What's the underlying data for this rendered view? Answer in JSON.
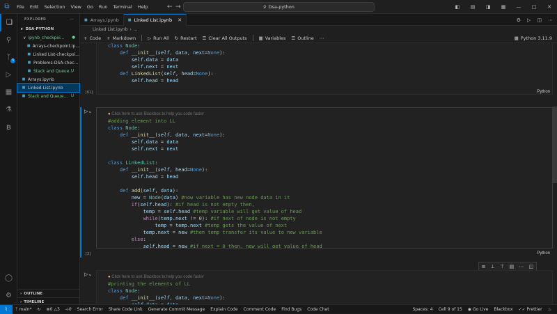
{
  "window": {
    "menu": [
      "File",
      "Edit",
      "Selection",
      "View",
      "Go",
      "Run",
      "Terminal",
      "Help"
    ],
    "search": "Dsa-python"
  },
  "explorer": {
    "title": "EXPLORER",
    "root": "DSA-PYTHON",
    "items": [
      {
        "label": "ipynb_checkpoi...",
        "status": "",
        "indent": 1,
        "folder": true,
        "git": true
      },
      {
        "label": "Arrays-checkpoint.ip...",
        "status": "",
        "indent": 2
      },
      {
        "label": "Linked List-checkpoi...",
        "status": "",
        "indent": 2
      },
      {
        "label": "Problems-DSA-chec...",
        "status": "",
        "indent": 2
      },
      {
        "label": "Stack and Queue...",
        "status": "U",
        "indent": 2,
        "git": true
      },
      {
        "label": "Arrays.ipynb",
        "status": "",
        "indent": 1
      },
      {
        "label": "Linked List.ipynb",
        "status": "",
        "indent": 1,
        "selected": true
      },
      {
        "label": "Stack and Queue...",
        "status": "U",
        "indent": 1,
        "git": true
      }
    ],
    "outline": "OUTLINE",
    "timeline": "TIMELINE"
  },
  "tabs": [
    {
      "label": "Arrays.ipynb",
      "active": false
    },
    {
      "label": "Linked List.ipynb",
      "active": true
    }
  ],
  "breadcrumb": [
    "Linked List.ipynb",
    "..."
  ],
  "toolbar": {
    "code": "Code",
    "markdown": "Markdown",
    "run_all": "Run All",
    "restart": "Restart",
    "clear_all": "Clear All Outputs",
    "variables": "Variables",
    "outline": "Outline",
    "kernel": "Python 3.11.9"
  },
  "cells": [
    {
      "count": "[61]",
      "lang": "Python",
      "lines": [
        "class Node:",
        "    def __init__(self, data, next=None):",
        "        self.data = data",
        "        self.next = next",
        "    def LinkedList(self, head=None):",
        "        self.head = head"
      ]
    },
    {
      "count": "[3]",
      "lang": "Python",
      "hint": "Click here to ask Blackbox to help you code faster",
      "lines": [
        "#adding element into LL",
        "class Node:",
        "    def __init__(self, data, next=None):",
        "        self.data = data",
        "        self.next = next",
        "",
        "class LinkedList:",
        "    def __init__(self, head=None):",
        "        self.head = head",
        "",
        "    def add(self, data):",
        "        new = Node(data) #now variable has new node data in it",
        "        if(self.head): #if head is not empty then,",
        "            temp = self.head #temp variable will get value of head",
        "            while(temp.next != 0): #if next of node is not empty",
        "                temp = temp.next #temp gets the value of next",
        "            temp.next = new #then temp transfer its value to new variable",
        "        else:",
        "            self.head = new #if next = 0 then, new will get value of head"
      ]
    },
    {
      "count": "",
      "lang": "",
      "hint": "Click here to ask Blackbox to help you code faster",
      "lines": [
        "#printing the elements of LL",
        "class Node:",
        "    def __init__(self, data, next=None):",
        "        self.data = data"
      ]
    }
  ],
  "statusbar": {
    "branch": "main*",
    "sync": "",
    "problems": "0",
    "warnings": "3",
    "ports": "0",
    "left_items": [
      "Search Error",
      "Share Code Link",
      "Generate Commit Message",
      "Explain Code",
      "Comment Code",
      "Find Bugs",
      "Code Chat"
    ],
    "right_items": [
      "Spaces: 4",
      "Cell 9 of 15",
      "Go Live",
      "Blackbox",
      "Prettier"
    ]
  },
  "colors": {
    "accent": "#0078d4",
    "git_untracked": "#73c991"
  }
}
